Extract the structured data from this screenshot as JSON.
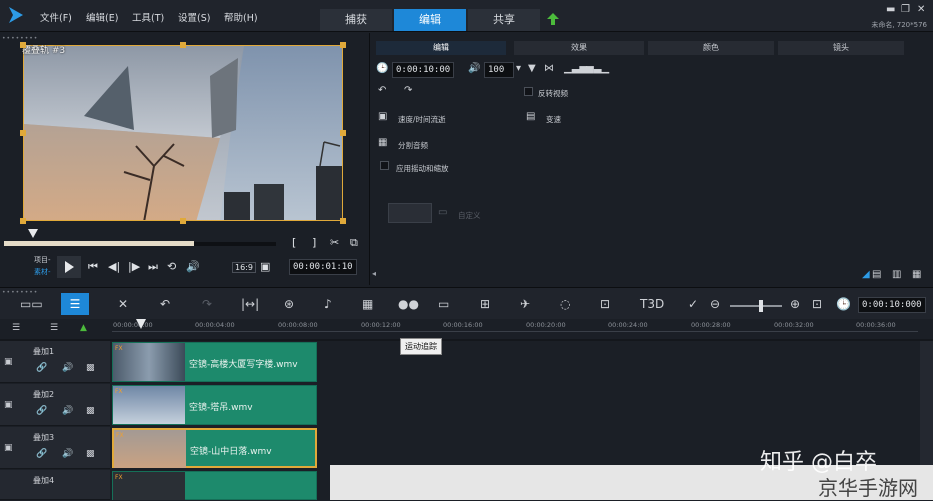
{
  "menu": {
    "file": "文件(F)",
    "edit": "编辑(E)",
    "tools": "工具(T)",
    "settings": "设置(S)",
    "help": "帮助(H)"
  },
  "tabs": {
    "capture": "捕获",
    "edit": "编辑",
    "share": "共享"
  },
  "project": {
    "info": "未命名, 720*576"
  },
  "preview": {
    "track_label": "覆叠轨 #3",
    "project_label": "项目-",
    "clip_label": "素材-",
    "aspect": "16:9",
    "timecode": "00:00:01:10"
  },
  "options": {
    "tabs": [
      "编辑",
      "效果",
      "颜色",
      "镜头"
    ],
    "duration": "0:00:10:00",
    "volume": "100",
    "reverse_label": "反转视频",
    "speed_label": "速度/时间流逝",
    "variable_speed_label": "变速",
    "split_audio_label": "分割音频",
    "pan_zoom_label": "应用摇动和缩放",
    "custom_label": "自定义"
  },
  "toolbar": {
    "timecode": "0:00:10:000"
  },
  "ruler": [
    "00:00:00:00",
    "00:00:04:00",
    "00:00:08:00",
    "00:00:12:00",
    "00:00:16:00",
    "00:00:20:00",
    "00:00:24:00",
    "00:00:28:00",
    "00:00:32:00",
    "00:00:36:00"
  ],
  "tooltip": "运动追踪",
  "tracks": [
    {
      "name": "叠加1",
      "clip": "空镜-高楼大厦写字楼.wmv"
    },
    {
      "name": "叠加2",
      "clip": "空镜-塔吊.wmv"
    },
    {
      "name": "叠加3",
      "clip": "空镜-山中日落.wmv"
    },
    {
      "name": "叠加4",
      "clip": ""
    }
  ],
  "watermark": {
    "zhihu": "知乎 @白卒",
    "site": "京华手游网"
  },
  "colors": {
    "accent": "#1e88d8",
    "clip": "#1d8a6c",
    "selection": "#e0a93a"
  }
}
